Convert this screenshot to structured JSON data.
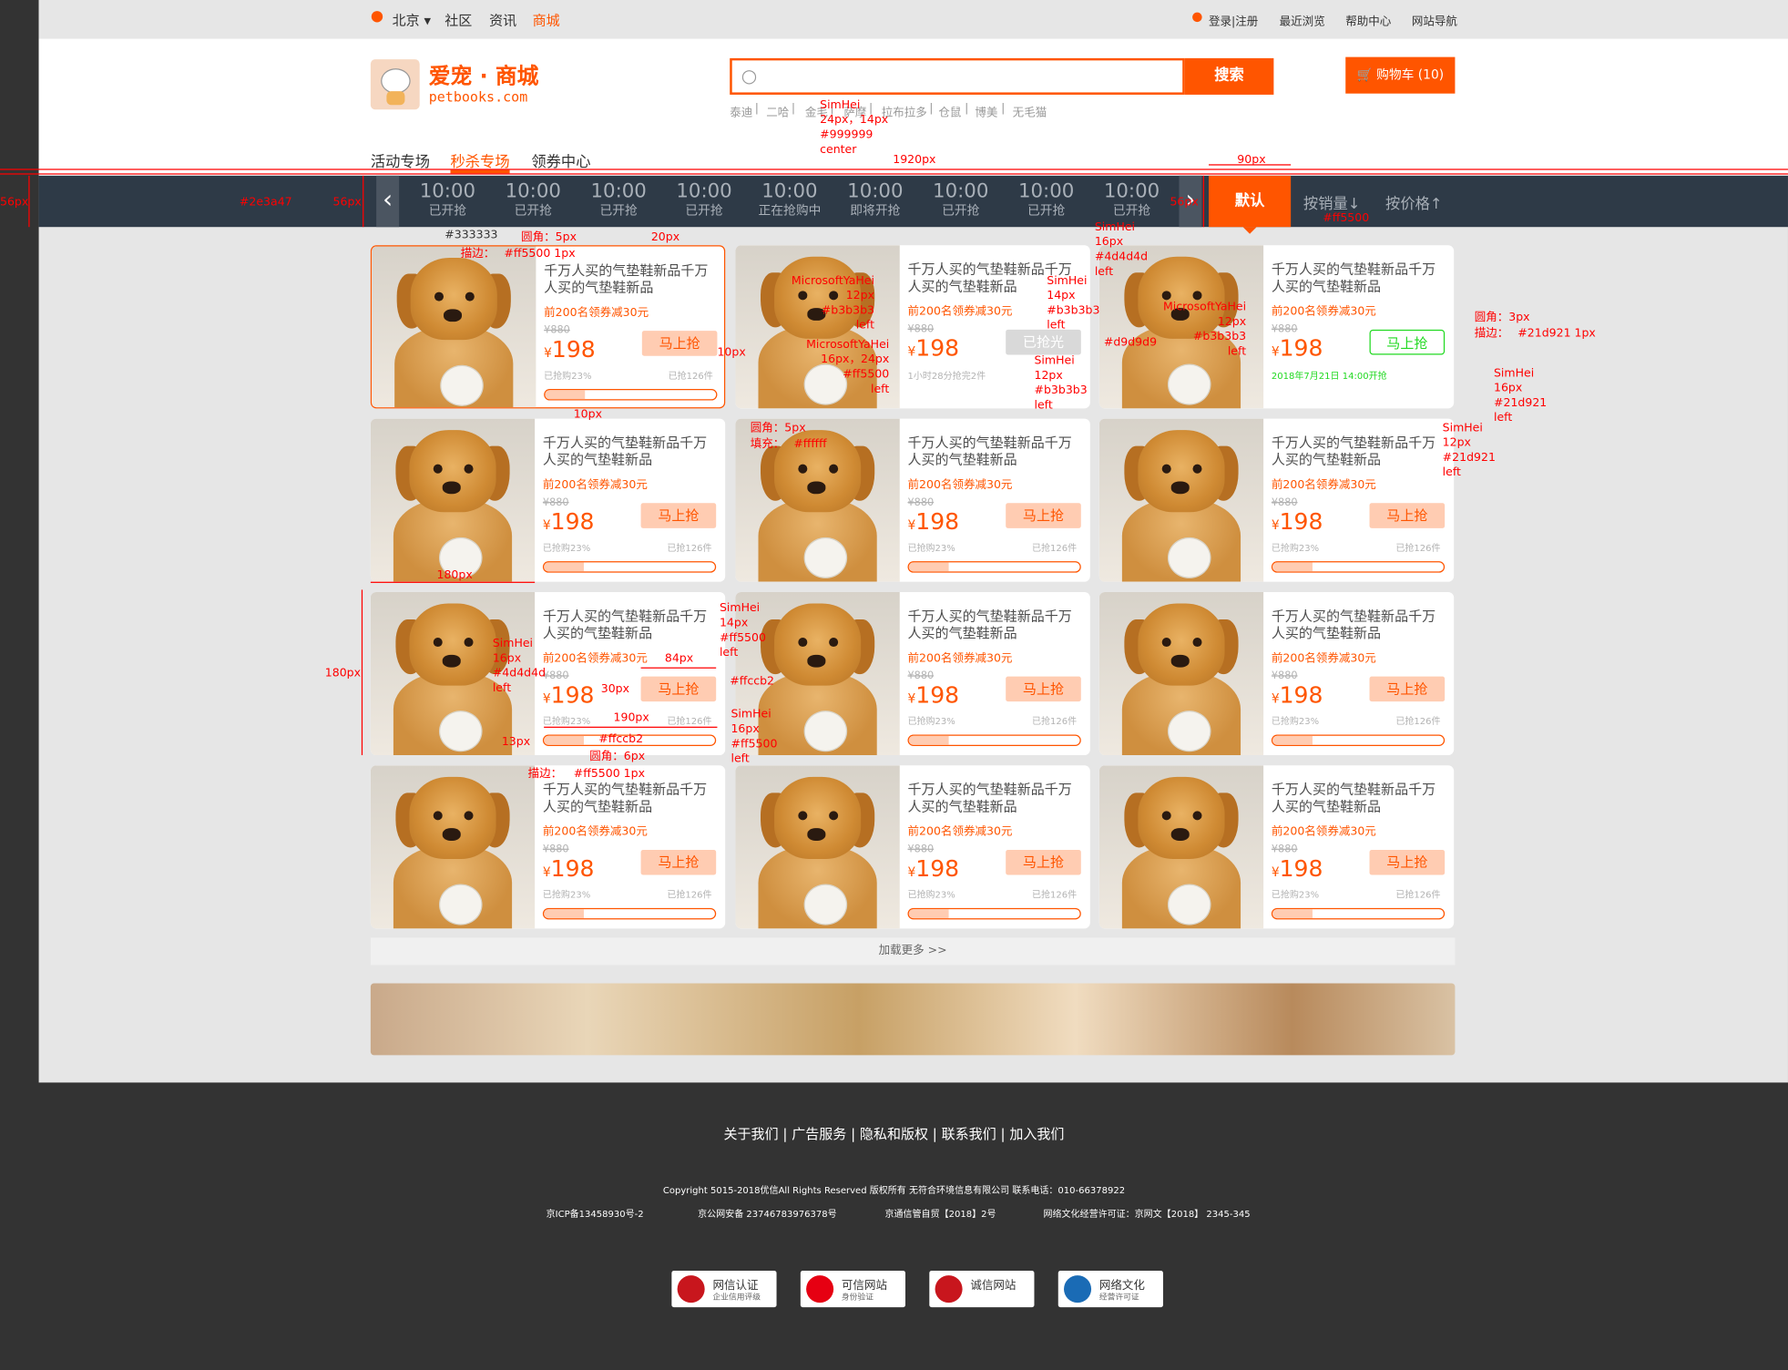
{
  "topbar": {
    "city": "北京",
    "nav": [
      "社区",
      "资讯",
      "商城"
    ],
    "login": "登录|注册",
    "links": [
      "最近浏览",
      "帮助中心",
      "网站导航"
    ]
  },
  "header": {
    "logo_title": "爱宠 · 商城",
    "logo_url": "petbooks.com",
    "search_button": "搜索",
    "search_placeholder": "",
    "hot_words": [
      "泰迪",
      "二哈",
      "金毛",
      "萨摩",
      "拉布拉多",
      "仓鼠",
      "博美",
      "无毛猫"
    ],
    "cart": "购物车 (10)"
  },
  "tabs": [
    "活动专场",
    "秒杀专场",
    "领券中心"
  ],
  "active_tab": 1,
  "timeslots": [
    {
      "time": "10:00",
      "status": "已开抢"
    },
    {
      "time": "10:00",
      "status": "已开抢"
    },
    {
      "time": "10:00",
      "status": "已开抢"
    },
    {
      "time": "10:00",
      "status": "已开抢"
    },
    {
      "time": "10:00",
      "status": "正在抢购中"
    },
    {
      "time": "10:00",
      "status": "即将开抢"
    },
    {
      "time": "10:00",
      "status": "已开抢"
    },
    {
      "time": "10:00",
      "status": "已开抢"
    },
    {
      "time": "10:00",
      "status": "已开抢"
    }
  ],
  "sort": [
    "默认",
    "按销量↓",
    "按价格↑"
  ],
  "product": {
    "title": "千万人买的气垫鞋新品千万人买的气垫鞋新品",
    "promo": "前200名领券减30元",
    "old_price": "¥880",
    "currency": "¥",
    "price": "198",
    "buy": "马上抢",
    "sold_out": "已抢光",
    "sold": "已抢购23%",
    "total": "已抢126件",
    "countdown": "1小时28分抢完2件",
    "start_time": "2018年7月21日 14:00开抢",
    "progress": 0.23
  },
  "load_more": "加载更多 >>",
  "footer": {
    "links": "关于我们  |  广告服务  |  隐私和版权  |  联系我们  |  加入我们",
    "copyright": "Copyright  5015-2018优信All Rights Reserved 版权所有  无符合环境信息有限公司   联系电话：010-66378922",
    "icp": [
      "京ICP备13458930号-2",
      "京公网安备 23746783976378号",
      "京通信管自贸【2018】2号",
      "网络文化经营许可证：京网文【2018】 2345-345"
    ],
    "badges": [
      {
        "title": "网信认证",
        "sub": "企业信用评级",
        "color": "#c8161d"
      },
      {
        "title": "可信网站",
        "sub": "身份验证",
        "color": "#e60012"
      },
      {
        "title": "诚信网站",
        "sub": "",
        "color": "#c8161d"
      },
      {
        "title": "网络文化",
        "sub": "经营许可证",
        "color": "#1a6bb5"
      }
    ]
  },
  "colors": {
    "accent": "#ff5500",
    "navbar": "#2e3a47",
    "text": "#4d4d4d",
    "muted": "#b3b3b3",
    "green": "#21d921",
    "light_accent": "#ffccb2"
  },
  "annotations": {
    "a1": "SimHei",
    "a2": "24px，14px",
    "a3": "#999999",
    "a4": "center",
    "w1920": "1920px",
    "w90": "90px",
    "h56a": "56px",
    "h56b": "56px",
    "h56c": "56px",
    "navcolor": "#2e3a47",
    "c333": "#333333",
    "accentlbl": "#ff5500",
    "r1": "圆角：5px",
    "s1": "描边：",
    "s1v": "#ff5500  1px",
    "px20": "20px",
    "px10a": "10px",
    "px10b": "10px",
    "r2": "圆角：5px",
    "fill": "填充：",
    "fillv": "#ffffff",
    "w180": "180px",
    "h180": "180px",
    "m1a": "MicrosoftYaHei",
    "m1b": "12px",
    "m1c": "#b3b3b3",
    "m1d": "left",
    "m2a": "MicrosoftYaHei",
    "m2b": "16px，24px",
    "m2c": "#ff5500",
    "m2d": "left",
    "s3a": "SimHei",
    "s3b": "12px",
    "s3c": "#b3b3b3",
    "s3d": "left",
    "s4a": "SimHei",
    "s4b": "14px",
    "s4c": "#b3b3b3",
    "s4d": "left",
    "s5a": "SimHei",
    "s5b": "16px",
    "s5c": "#4d4d4d",
    "s5d": "left",
    "grey": "#d9d9d9",
    "m3a": "MicrosoftYaHei",
    "m3b": "12px",
    "m3c": "#b3b3b3",
    "m3d": "left",
    "r3": "圆角：3px",
    "s6": "描边：",
    "s6v": "#21d921  1px",
    "s7a": "SimHei",
    "s7b": "16px",
    "s7c": "#21d921",
    "s7d": "left",
    "s8a": "SimHei",
    "s8b": "12px",
    "s8c": "#21d921",
    "s8d": "left",
    "s9a": "SimHei",
    "s9b": "16px",
    "s9c": "#4d4d4d",
    "s9d": "left",
    "s10a": "SimHei",
    "s10b": "14px",
    "s10c": "#ff5500",
    "s10d": "left",
    "w84": "84px",
    "h30": "30px",
    "btncol": "#ffccb2",
    "w190": "190px",
    "h13": "13px",
    "barcol": "#ffccb2",
    "s11a": "SimHei",
    "s11b": "16px",
    "s11c": "#ff5500",
    "s11d": "left",
    "r4": "圆角：6px",
    "s12": "描边：",
    "s12v": "#ff5500  1px"
  }
}
